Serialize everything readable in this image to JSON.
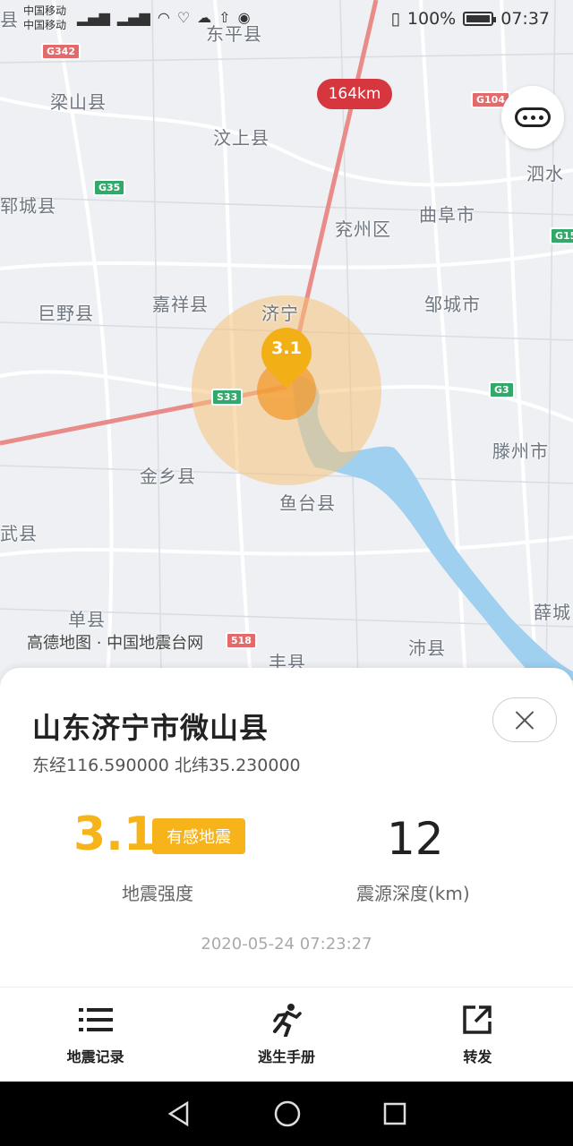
{
  "status_bar": {
    "carrier_1": "中国移动",
    "carrier_2": "中国移动",
    "battery_percent": "100%",
    "battery_level": 1.0,
    "time": "07:37"
  },
  "map": {
    "labels": {
      "dongping": "东平县",
      "liangshan": "梁山县",
      "wenshang": "汶上县",
      "yuncheng": "郓城县",
      "yanzhou": "兖州区",
      "qufu": "曲阜市",
      "sishui": "泗水",
      "jiaxiang": "嘉祥县",
      "jining": "济宁",
      "juye": "巨野县",
      "zoucheng": "邹城市",
      "jinxiang": "金乡县",
      "tengzhou": "滕州市",
      "yutai": "鱼台县",
      "chengwu": "武县",
      "shan": "单县",
      "xue": "薛城",
      "pei": "沛县",
      "feng": "丰县",
      "left_edge": "县"
    },
    "shields": {
      "g342": "G342",
      "g104": "G104",
      "g35": "G35",
      "g15": "G15",
      "g3": "G3",
      "s33": "S33",
      "s518": "518"
    },
    "distance": "164km",
    "magnitude_marker": "3.1",
    "attribution": "高德地图 · 中国地震台网"
  },
  "info": {
    "place": "山东济宁市微山县",
    "coordinates": "东经116.590000  北纬35.230000",
    "magnitude": "3.1",
    "felt_badge": "有感地震",
    "magnitude_label": "地震强度",
    "depth": "12",
    "depth_label": "震源深度(km)",
    "timestamp": "2020-05-24 07:23:27"
  },
  "nav": {
    "records": "地震记录",
    "escape": "逃生手册",
    "share": "转发"
  },
  "colors": {
    "accent": "#f6b41a",
    "distance_red": "#d6363d",
    "water": "#9fd0f0"
  }
}
